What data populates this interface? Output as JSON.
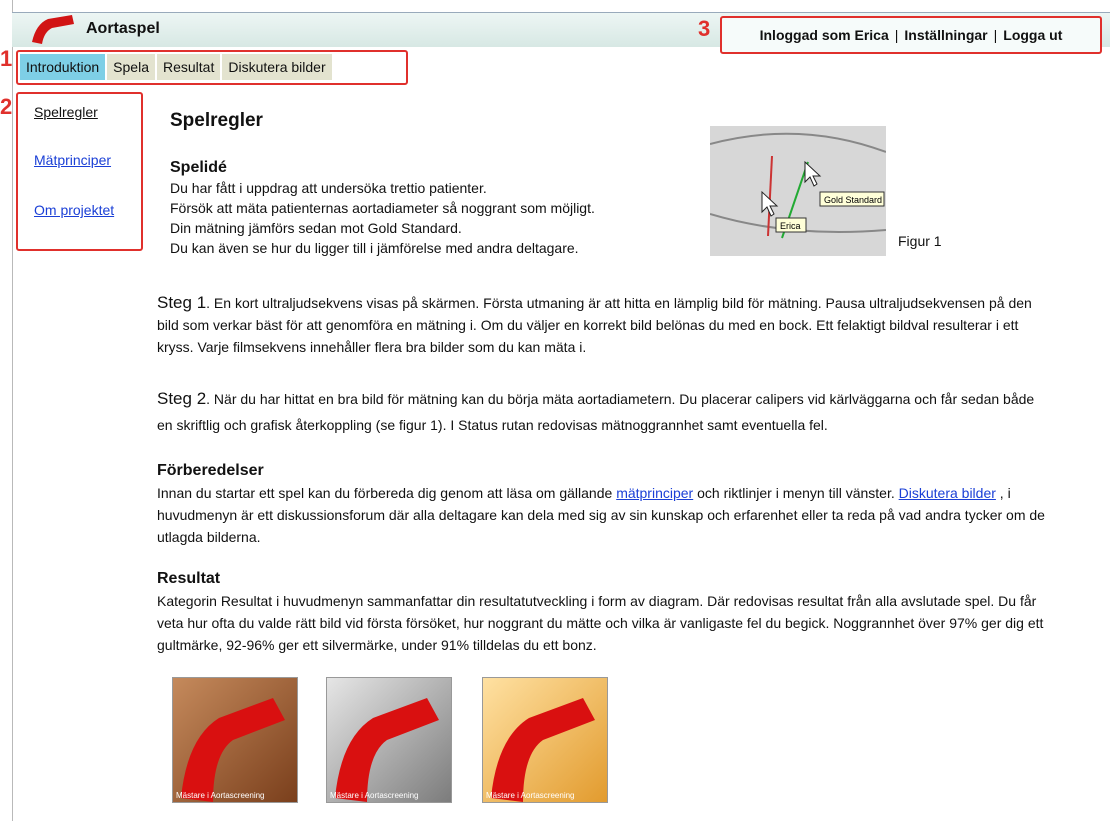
{
  "header": {
    "app_title": "Aortaspel",
    "user_text": "Inloggad som Erica",
    "settings_label": "Inställningar",
    "logout_label": "Logga ut",
    "separator": "|"
  },
  "markers": {
    "m1": "1",
    "m2": "2",
    "m3": "3"
  },
  "tabs": [
    {
      "label": "Introduktion"
    },
    {
      "label": "Spela"
    },
    {
      "label": "Resultat"
    },
    {
      "label": "Diskutera bilder"
    }
  ],
  "sidebar": {
    "items": [
      {
        "label": "Spelregler"
      },
      {
        "label": "Mätprinciper"
      },
      {
        "label": "Om projektet"
      }
    ]
  },
  "main": {
    "title": "Spelregler",
    "idea_heading": "Spelidé",
    "idea_lines": [
      "Du har fått i uppdrag att undersöka trettio patienter.",
      "Försök att mäta patienternas aortadiameter så noggrant som möjligt.",
      "Din mätning jämförs sedan mot Gold Standard.",
      "Du kan även se hur du ligger till i jämförelse med andra deltagare."
    ],
    "figure": {
      "label_gold": "Gold Standard",
      "label_user": "Erica",
      "caption": "Figur 1"
    },
    "step1_head": "Steg 1",
    "step1_text": ". En kort ultraljudsekvens visas på skärmen. Första utmaning är att hitta en lämplig bild för mätning. Pausa ultraljudsekvensen på den bild som verkar bäst för att genomföra en mätning i. Om du väljer en korrekt bild belönas du med en bock. Ett felaktigt bildval resulterar i ett kryss. Varje filmsekvens innehåller flera bra bilder som du kan mäta i.",
    "step2_head": "Steg 2",
    "step2_text": ". När du har hittat en bra bild för mätning kan du börja mäta aortadiametern. Du placerar calipers vid kärlväggarna och får sedan både en skriftlig och grafisk återkoppling (se figur 1). I Status rutan redovisas mätnoggrannhet samt eventuella fel.",
    "prep_heading": "Förberedelser",
    "prep_text_a": "Innan du startar ett spel kan du förbereda dig genom att läsa om gällande ",
    "prep_link_a": "mätprinciper",
    "prep_text_b": " och riktlinjer i menyn till vänster.",
    "prep_link_b": "Diskutera bilder",
    "prep_text_c": " , i huvudmenyn är ett diskussionsforum där alla deltagare kan dela med sig av sin kunskap och erfarenhet eller ta reda på vad andra tycker om de utlagda bilderna.",
    "result_heading": "Resultat",
    "result_text": "Kategorin Resultat i huvudmenyn sammanfattar din resultatutveckling i form av diagram. Där redovisas resultat från alla avslutade spel. Du får veta hur ofta du valde rätt bild vid första försöket, hur noggrant du mätte och vilka är vanligaste fel du begick. Noggrannhet över 97% ger dig ett gultmärke, 92-96% ger ett silvermärke, under 91% tilldelas du ett bonz."
  },
  "badges": [
    {
      "caption": "Mästare i Aortascreening",
      "color": "#9a5a32"
    },
    {
      "caption": "Mästare i Aortascreening",
      "color": "#a6a6a6"
    },
    {
      "caption": "Mästare i Aortascreening",
      "color": "#e8a43a"
    }
  ],
  "colors": {
    "highlight_red": "#e0302c",
    "active_tab": "#7ecfe6",
    "tab_bg": "#e3e3cf",
    "link": "#1a3fd6"
  }
}
